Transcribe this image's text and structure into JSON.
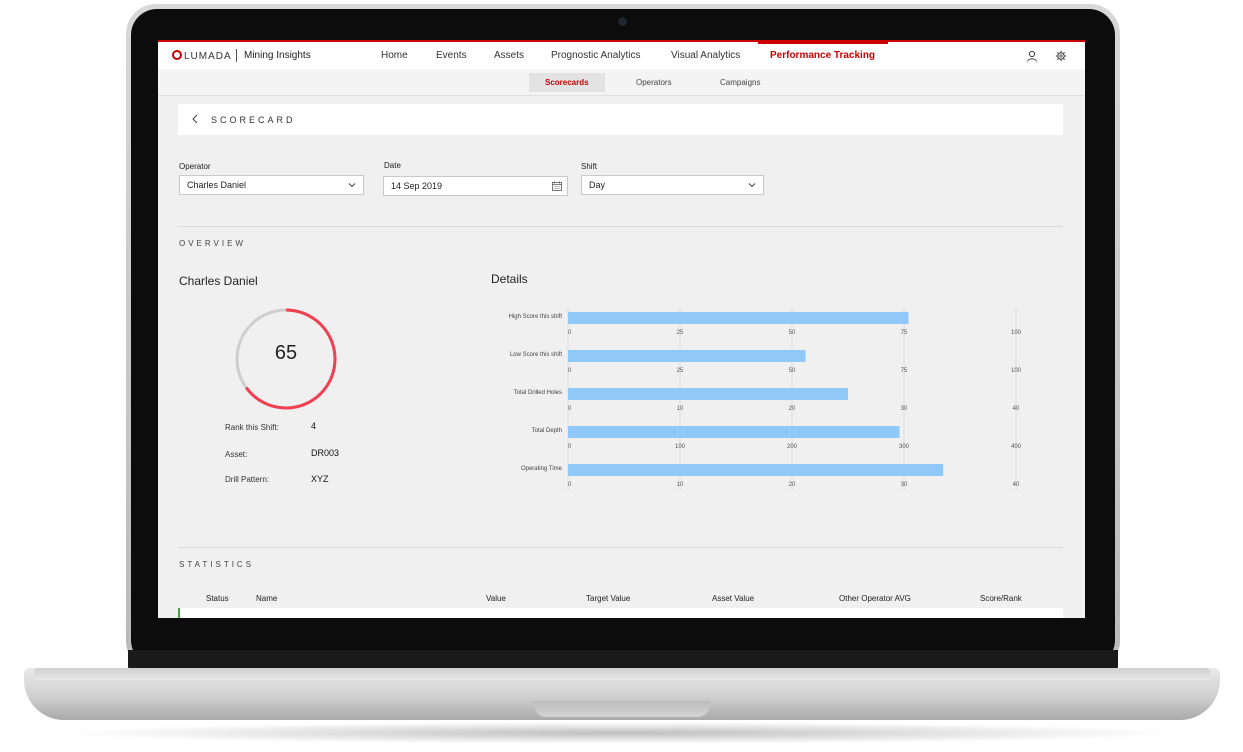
{
  "brand": {
    "logo": "LUMADA",
    "app_name": "Mining Insights",
    "accent": "#cc0000"
  },
  "nav": {
    "items": [
      "Home",
      "Events",
      "Assets",
      "Prognostic Analytics",
      "Visual Analytics"
    ],
    "active": "Performance Tracking"
  },
  "subnav": {
    "items": [
      "Scorecards",
      "Operators",
      "Campaigns"
    ],
    "active_index": 0
  },
  "header": {
    "title": "SCORECARD"
  },
  "filters": {
    "operator": {
      "label": "Operator",
      "value": "Charles Daniel"
    },
    "date": {
      "label": "Date",
      "value": "14 Sep 2019"
    },
    "shift": {
      "label": "Shift",
      "value": "Day"
    }
  },
  "overview": {
    "section_label": "OVERVIEW",
    "operator_name": "Charles Daniel",
    "score": "65",
    "score_fraction": 0.65,
    "rank_label": "Rank this Shift:",
    "rank_value": "4",
    "asset_label": "Asset:",
    "asset_value": "DR003",
    "pattern_label": "Drill Pattern:",
    "pattern_value": "XYZ"
  },
  "details_title": "Details",
  "chart_data": {
    "type": "bar",
    "orientation": "horizontal",
    "bar_color": "#90c8f8",
    "grid": true,
    "rows": [
      {
        "label": "High Score this shift",
        "value": 76,
        "xlim": [
          0,
          100
        ],
        "ticks": [
          0,
          25,
          50,
          75,
          100
        ]
      },
      {
        "label": "Low Score this shift",
        "value": 53,
        "xlim": [
          0,
          100
        ],
        "ticks": [
          0,
          25,
          50,
          75,
          100
        ]
      },
      {
        "label": "Total Drilled Holes",
        "value": 25,
        "xlim": [
          0,
          40
        ],
        "ticks": [
          0,
          10,
          20,
          30,
          40
        ]
      },
      {
        "label": "Total Depth",
        "value": 296,
        "xlim": [
          0,
          400
        ],
        "ticks": [
          0,
          100,
          200,
          300,
          400
        ]
      },
      {
        "label": "Operating Time",
        "value": 33.5,
        "xlim": [
          0,
          40
        ],
        "ticks": [
          0,
          10,
          20,
          30,
          40
        ]
      }
    ]
  },
  "statistics": {
    "section_label": "STATISTICS",
    "columns": [
      "Status",
      "Name",
      "Value",
      "Target Value",
      "Asset Value",
      "Other Operator AVG",
      "Score/Rank"
    ]
  }
}
